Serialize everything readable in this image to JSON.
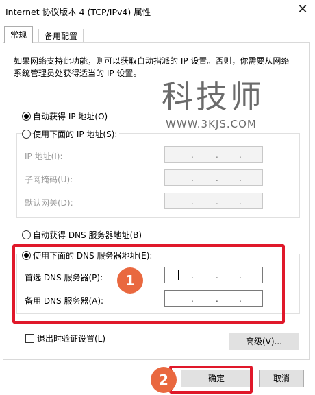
{
  "window": {
    "title": "Internet 协议版本 4 (TCP/IPv4) 属性",
    "close_glyph": "✕"
  },
  "tabs": [
    {
      "label": "常规",
      "active": true
    },
    {
      "label": "备用配置",
      "active": false
    }
  ],
  "description": "如果网络支持此功能，则可以获取自动指派的 IP 设置。否则，你需要从网络系统管理员处获得适当的 IP 设置。",
  "watermark": {
    "chars": [
      "科",
      "技",
      "师"
    ],
    "url": "WWW.3KJS.COM"
  },
  "ip": {
    "auto_label": "自动获得 IP 地址(O)",
    "auto_selected": true,
    "manual_label": "使用下面的 IP 地址(S):",
    "manual_selected": false,
    "fields": [
      {
        "label": "IP 地址(I):",
        "value": ". . ."
      },
      {
        "label": "子网掩码(U):",
        "value": ". . ."
      },
      {
        "label": "默认网关(D):",
        "value": ". . ."
      }
    ]
  },
  "dns": {
    "auto_label": "自动获得 DNS 服务器地址(B)",
    "auto_selected": false,
    "manual_label": "使用下面的 DNS 服务器地址(E):",
    "manual_selected": true,
    "fields": [
      {
        "label": "首选 DNS 服务器(P):",
        "value": ". . ."
      },
      {
        "label": "备用 DNS 服务器(A):",
        "value": ". . ."
      }
    ]
  },
  "validate": {
    "label": "退出时验证设置(L)",
    "checked": false
  },
  "advanced_button": "高级(V)...",
  "ok_button": "确定",
  "cancel_button": "取消",
  "annotations": {
    "badge1": "1",
    "badge2": "2",
    "highlight_color": "#e0182a",
    "badge_color": "#e9683f"
  }
}
